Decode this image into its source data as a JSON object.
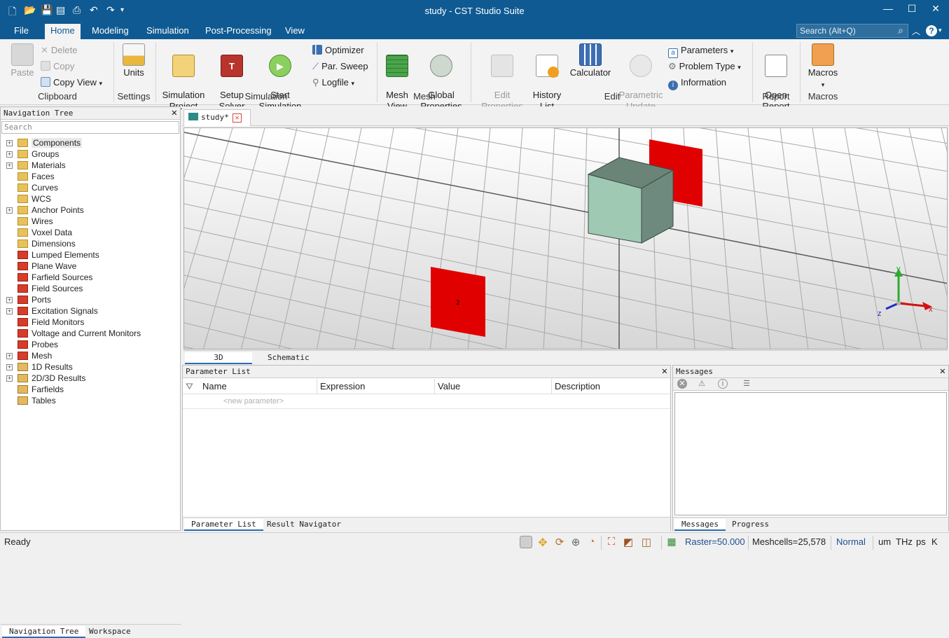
{
  "window": {
    "title": "study - CST Studio Suite"
  },
  "menu": {
    "tabs": [
      "File",
      "Home",
      "Modeling",
      "Simulation",
      "Post-Processing",
      "View"
    ],
    "search_placeholder": "Search (Alt+Q)"
  },
  "ribbon": {
    "clipboard": {
      "paste": "Paste",
      "delete": "Delete",
      "copy": "Copy",
      "copy_view": "Copy View",
      "group": "Clipboard"
    },
    "settings": {
      "units": "Units",
      "group": "Settings"
    },
    "simulation": {
      "sim_project": "Simulation\nProject",
      "setup_solver": "Setup\nSolver",
      "start_sim": "Start\nSimulation",
      "optimizer": "Optimizer",
      "par_sweep": "Par. Sweep",
      "logfile": "Logfile",
      "group": "Simulation"
    },
    "mesh": {
      "mesh_view": "Mesh\nView",
      "global_props": "Global\nProperties",
      "group": "Mesh"
    },
    "edit": {
      "edit_props": "Edit\nProperties",
      "history": "History\nList",
      "calculator": "Calculator",
      "param_update": "Parametric\nUpdate",
      "parameters": "Parameters",
      "problem_type": "Problem Type",
      "information": "Information",
      "group": "Edit"
    },
    "report": {
      "open_report": "Open\nReport",
      "group": "Report"
    },
    "macros": {
      "macros": "Macros",
      "group": "Macros"
    }
  },
  "nav": {
    "title": "Navigation Tree",
    "search_placeholder": "Search",
    "items": [
      {
        "label": "Components",
        "expand": true,
        "icon": "folder"
      },
      {
        "label": "Groups",
        "expand": true,
        "icon": "folder"
      },
      {
        "label": "Materials",
        "expand": true,
        "icon": "folder"
      },
      {
        "label": "Faces",
        "expand": false,
        "icon": "folder"
      },
      {
        "label": "Curves",
        "expand": false,
        "icon": "folder"
      },
      {
        "label": "WCS",
        "expand": false,
        "icon": "folder"
      },
      {
        "label": "Anchor Points",
        "expand": true,
        "icon": "folder"
      },
      {
        "label": "Wires",
        "expand": false,
        "icon": "folder"
      },
      {
        "label": "Voxel Data",
        "expand": false,
        "icon": "folder"
      },
      {
        "label": "Dimensions",
        "expand": false,
        "icon": "folder"
      },
      {
        "label": "Lumped Elements",
        "expand": false,
        "icon": "red"
      },
      {
        "label": "Plane Wave",
        "expand": false,
        "icon": "red"
      },
      {
        "label": "Farfield Sources",
        "expand": false,
        "icon": "red"
      },
      {
        "label": "Field Sources",
        "expand": false,
        "icon": "red"
      },
      {
        "label": "Ports",
        "expand": true,
        "icon": "red"
      },
      {
        "label": "Excitation Signals",
        "expand": true,
        "icon": "red"
      },
      {
        "label": "Field Monitors",
        "expand": false,
        "icon": "red"
      },
      {
        "label": "Voltage and Current Monitors",
        "expand": false,
        "icon": "red"
      },
      {
        "label": "Probes",
        "expand": false,
        "icon": "red"
      },
      {
        "label": "Mesh",
        "expand": true,
        "icon": "red"
      },
      {
        "label": "1D Results",
        "expand": true,
        "icon": "stack"
      },
      {
        "label": "2D/3D Results",
        "expand": true,
        "icon": "stack"
      },
      {
        "label": "Farfields",
        "expand": false,
        "icon": "stack"
      },
      {
        "label": "Tables",
        "expand": false,
        "icon": "stack"
      }
    ],
    "tabs": [
      "Navigation Tree",
      "Workspace"
    ]
  },
  "doc": {
    "tab": "study*",
    "view_tabs": [
      "3D",
      "Schematic"
    ],
    "port_label": "2",
    "axes": {
      "x": "x",
      "y": "y",
      "z": "z"
    }
  },
  "params": {
    "title": "Parameter List",
    "columns": [
      "Name",
      "Expression",
      "Value",
      "Description"
    ],
    "new_param": "<new parameter>",
    "tabs": [
      "Parameter List",
      "Result Navigator"
    ]
  },
  "messages": {
    "title": "Messages",
    "tabs": [
      "Messages",
      "Progress"
    ]
  },
  "status": {
    "ready": "Ready",
    "raster": "Raster=50.000",
    "meshcells": "Meshcells=25,578",
    "mode": "Normal",
    "units": "um",
    "freq": "THz",
    "time": "ps",
    "temp": "K"
  },
  "colors": {
    "titlebar": "#0f5a92",
    "port_red": "#e00000",
    "cube_face": "#9fc9b3",
    "cube_top": "#6b8478"
  }
}
